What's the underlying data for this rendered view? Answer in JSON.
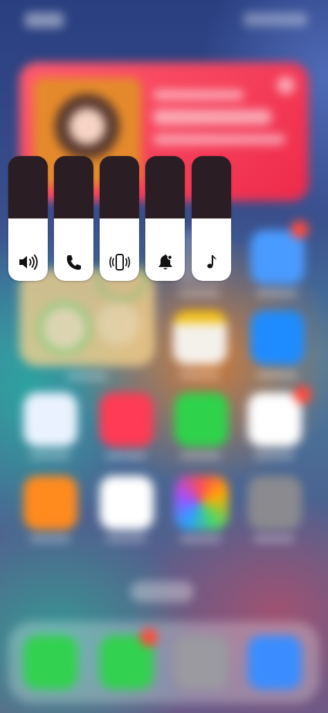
{
  "sliders": [
    {
      "name": "volume",
      "icon": "speaker-icon",
      "level": 0.5
    },
    {
      "name": "ringer",
      "icon": "phone-icon",
      "level": 0.5
    },
    {
      "name": "vibration",
      "icon": "vibrate-icon",
      "level": 0.5
    },
    {
      "name": "notifications",
      "icon": "bell-icon",
      "level": 0.5
    },
    {
      "name": "media",
      "icon": "music-note-icon",
      "level": 0.5
    }
  ],
  "colors": {
    "slider_track": "#2b1d24",
    "slider_fill": "#ffffff",
    "icon": "#111111"
  }
}
